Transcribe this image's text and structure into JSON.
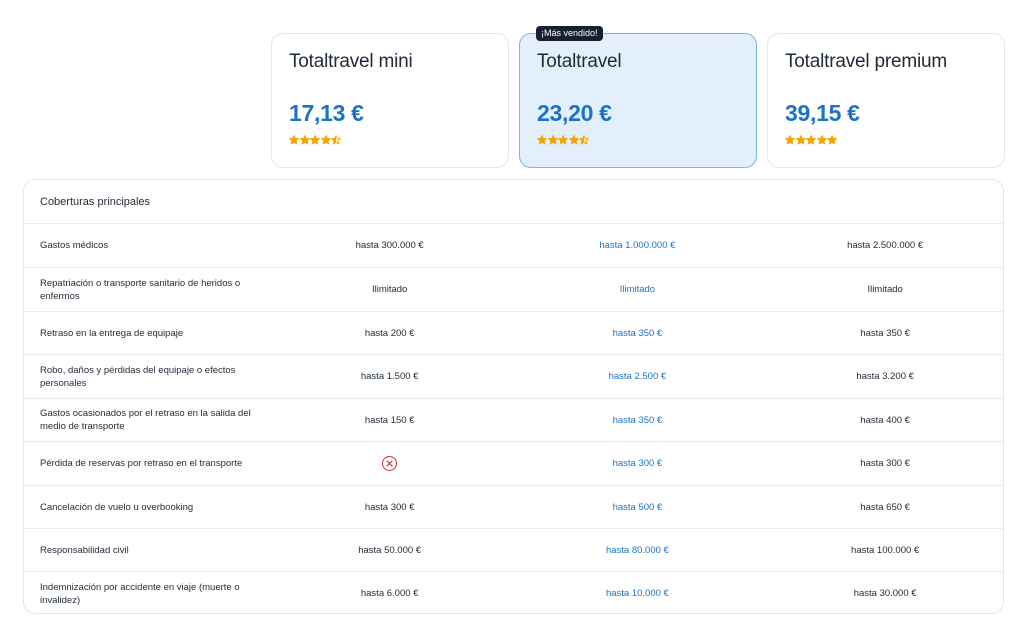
{
  "plans": [
    {
      "name": "Totaltravel mini",
      "price": "17,13 €",
      "rating": 4.5,
      "badge": ""
    },
    {
      "name": "Totaltravel",
      "price": "23,20 €",
      "rating": 4.5,
      "badge": "¡Más vendido!"
    },
    {
      "name": "Totaltravel premium",
      "price": "39,15 €",
      "rating": 5,
      "badge": ""
    }
  ],
  "colors": {
    "accent": "#1a73c6",
    "star": "#f0a500",
    "featured_bg": "#e3f0fc",
    "not_included": "#c0392b"
  },
  "coverage": {
    "title": "Coberturas principales",
    "rows": [
      {
        "label": "Gastos médicos",
        "values": [
          "hasta 300.000 €",
          "hasta 1.000.000 €",
          "hasta 2.500.000 €"
        ]
      },
      {
        "label": "Repatriación o transporte sanitario de heridos o enfermos",
        "values": [
          "Ilimitado",
          "Ilimitado",
          "Ilimitado"
        ]
      },
      {
        "label": "Retraso en la entrega de equipaje",
        "values": [
          "hasta 200 €",
          "hasta 350 €",
          "hasta 350 €"
        ]
      },
      {
        "label": "Robo, daños y pérdidas del equipaje o efectos personales",
        "values": [
          "hasta 1.500 €",
          "hasta 2.500 €",
          "hasta 3.200 €"
        ]
      },
      {
        "label": "Gastos ocasionados por el retraso en la salida del medio de transporte",
        "values": [
          "hasta 150 €",
          "hasta 350 €",
          "hasta 400 €"
        ]
      },
      {
        "label": "Pérdida de reservas por retraso en el transporte",
        "values": [
          "",
          "hasta 300 €",
          "hasta 300 €"
        ],
        "not_included": [
          true,
          false,
          false
        ],
        "not_included_icon": "close-circle-icon"
      },
      {
        "label": "Cancelación de vuelo u overbooking",
        "values": [
          "hasta 300 €",
          "hasta 500 €",
          "hasta 650 €"
        ]
      },
      {
        "label": "Responsabilidad civil",
        "values": [
          "hasta 50.000 €",
          "hasta 80.000 €",
          "hasta 100.000 €"
        ]
      },
      {
        "label": "Indemnización por accidente en viaje (muerte o invalidez)",
        "values": [
          "hasta 6.000 €",
          "hasta 10.000 €",
          "hasta 30.000 €"
        ]
      }
    ]
  }
}
